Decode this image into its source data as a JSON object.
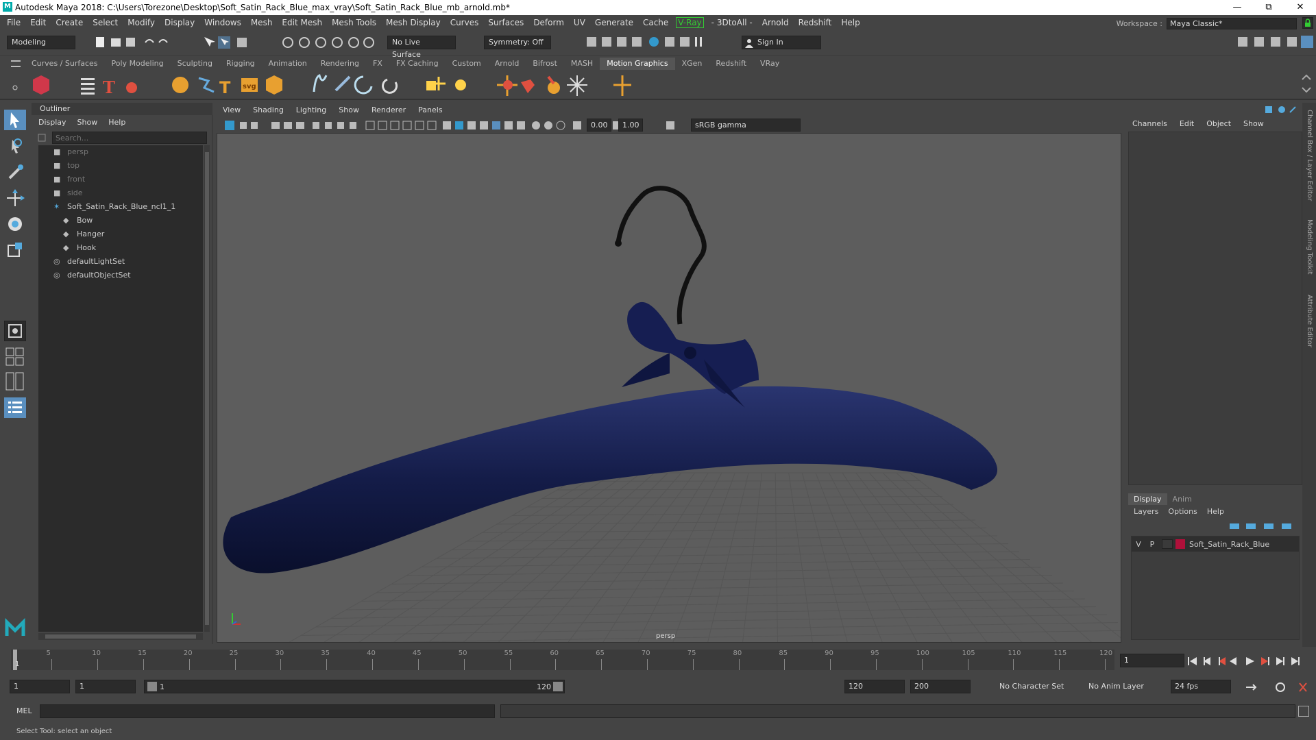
{
  "title": "Autodesk Maya 2018: C:\\Users\\Torezone\\Desktop\\Soft_Satin_Rack_Blue_max_vray\\Soft_Satin_Rack_Blue_mb_arnold.mb*",
  "menu": [
    "File",
    "Edit",
    "Create",
    "Select",
    "Modify",
    "Display",
    "Windows",
    "Mesh",
    "Edit Mesh",
    "Mesh Tools",
    "Mesh Display",
    "Curves",
    "Surfaces",
    "Deform",
    "UV",
    "Generate",
    "Cache"
  ],
  "menu2": [
    "- 3DtoAll -",
    "Arnold",
    "Redshift",
    "Help"
  ],
  "vray": "V-Ray",
  "workspace": {
    "label": "Workspace :",
    "value": "Maya Classic*"
  },
  "status": {
    "mode": "Modeling",
    "live_surface": "No Live Surface",
    "symmetry": "Symmetry: Off",
    "sign_in": "Sign In"
  },
  "shelf_tabs": [
    "Curves / Surfaces",
    "Poly Modeling",
    "Sculpting",
    "Rigging",
    "Animation",
    "Rendering",
    "FX",
    "FX Caching",
    "Custom",
    "Arnold",
    "Bifrost",
    "MASH",
    "Motion Graphics",
    "XGen",
    "Redshift",
    "VRay"
  ],
  "shelf_active": "Motion Graphics",
  "outliner": {
    "title": "Outliner",
    "menu": [
      "Display",
      "Show",
      "Help"
    ],
    "search_placeholder": "Search...",
    "items": [
      {
        "label": "persp",
        "dim": true,
        "indent": 0
      },
      {
        "label": "top",
        "dim": true,
        "indent": 0
      },
      {
        "label": "front",
        "dim": true,
        "indent": 0
      },
      {
        "label": "side",
        "dim": true,
        "indent": 0
      },
      {
        "label": "Soft_Satin_Rack_Blue_ncl1_1",
        "dim": false,
        "indent": 0
      },
      {
        "label": "Bow",
        "dim": false,
        "indent": 1
      },
      {
        "label": "Hanger",
        "dim": false,
        "indent": 1
      },
      {
        "label": "Hook",
        "dim": false,
        "indent": 1
      },
      {
        "label": "defaultLightSet",
        "dim": false,
        "indent": 0
      },
      {
        "label": "defaultObjectSet",
        "dim": false,
        "indent": 0
      }
    ]
  },
  "viewport": {
    "menu": [
      "View",
      "Shading",
      "Lighting",
      "Show",
      "Renderer",
      "Panels"
    ],
    "field1": "0.00",
    "field2": "1.00",
    "colorspace": "sRGB gamma",
    "camera": "persp"
  },
  "channelbox": {
    "menu": [
      "Channels",
      "Edit",
      "Object",
      "Show"
    ]
  },
  "layers": {
    "tabs": [
      "Display",
      "Anim"
    ],
    "menu": [
      "Layers",
      "Options",
      "Help"
    ],
    "layer": {
      "v": "V",
      "p": "P",
      "name": "Soft_Satin_Rack_Blue",
      "color": "#b0103a"
    }
  },
  "side_tabs": [
    "Channel Box / Layer Editor",
    "Modeling Toolkit",
    "Attribute Editor"
  ],
  "timeline": {
    "ticks": [
      "5",
      "10",
      "15",
      "20",
      "25",
      "30",
      "35",
      "40",
      "45",
      "50",
      "55",
      "60",
      "65",
      "70",
      "75",
      "80",
      "85",
      "90",
      "95",
      "100",
      "105",
      "110",
      "115",
      "120"
    ],
    "start_label": "1",
    "current": "1"
  },
  "range": {
    "start": "1",
    "anim_start": "1",
    "slider_start": "1",
    "slider_end": "120",
    "end": "120",
    "anim_end": "200",
    "char_set": "No Character Set",
    "anim_layer": "No Anim Layer",
    "fps": "24 fps"
  },
  "cmd": {
    "label": "MEL"
  },
  "help_line": "Select Tool: select an object"
}
